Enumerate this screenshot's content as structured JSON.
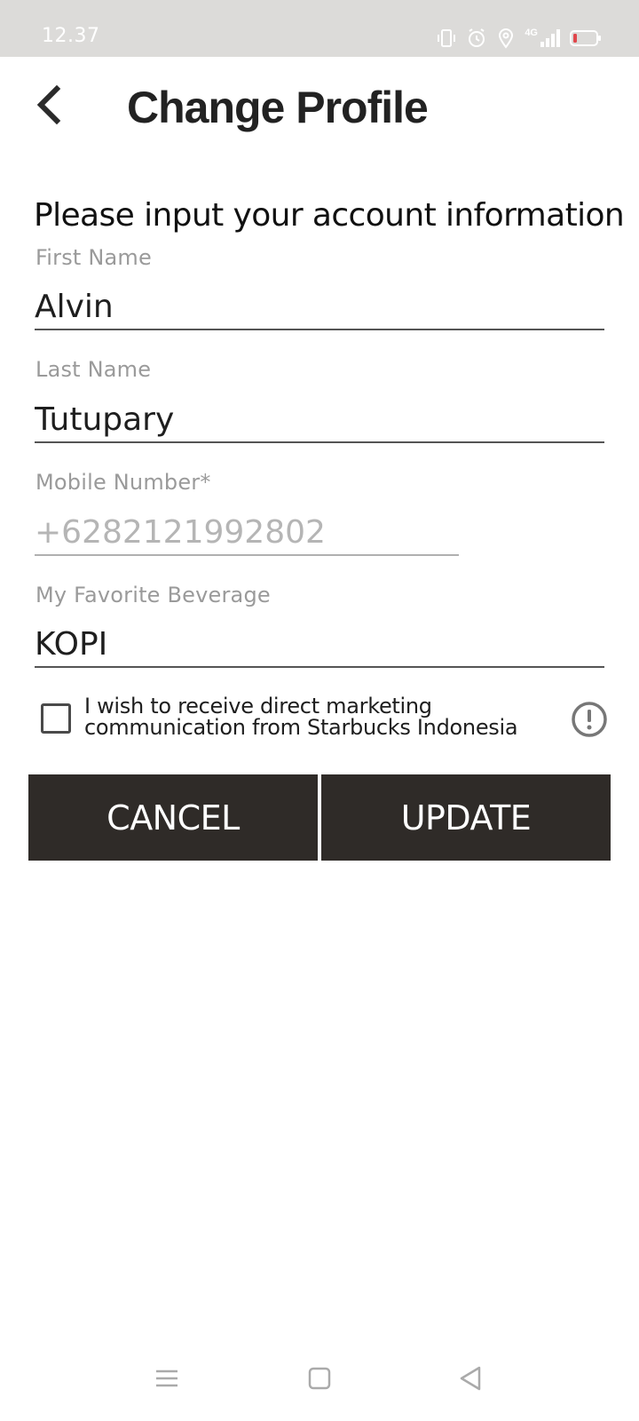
{
  "status_bar": {
    "time": "12.37",
    "icons": [
      "vibrate-icon",
      "alarm-icon",
      "location-icon",
      "signal-4g-icon",
      "battery-icon"
    ],
    "network_label": "4G"
  },
  "header": {
    "title": "Change Profile",
    "back_icon": "chevron-left-icon"
  },
  "form": {
    "subtitle": "Please input your account information",
    "first_name": {
      "label": "First Name",
      "value": "Alvin"
    },
    "last_name": {
      "label": "Last Name",
      "value": "Tutupary"
    },
    "mobile": {
      "label": "Mobile Number*",
      "value": "+6282121992802"
    },
    "beverage": {
      "label": "My Favorite Beverage",
      "value": "KOPI"
    },
    "consent": {
      "text": "I wish to receive direct marketing communication from Starbucks Indonesia",
      "checked": false
    }
  },
  "buttons": {
    "cancel": "CANCEL",
    "update": "UPDATE"
  },
  "colors": {
    "button_bg": "#2f2b28",
    "status_bar_bg": "#dcdbd9",
    "battery_low": "#e0474c"
  },
  "nav": {
    "icons": [
      "menu-icon",
      "home-icon",
      "back-triangle-icon"
    ]
  }
}
